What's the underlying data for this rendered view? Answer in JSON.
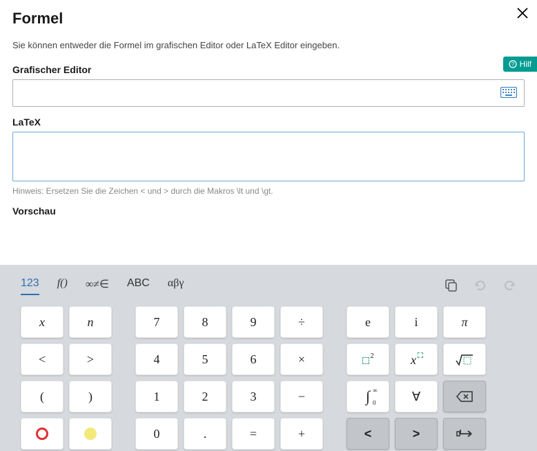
{
  "dialog": {
    "title": "Formel",
    "intro": "Sie können entweder die Formel im grafischen Editor oder LaTeX Editor eingeben.",
    "help_label": "Hilf"
  },
  "fields": {
    "graphical_label": "Grafischer Editor",
    "graphical_value": "",
    "latex_label": "LaTeX",
    "latex_value": "",
    "hint": "Hinweis: Ersetzen Sie die Zeichen < und >  durch die Makros \\lt und \\gt.",
    "preview_label": "Vorschau"
  },
  "tabs": {
    "t123": "123",
    "tf": "f()",
    "tinf": "∞≠∈",
    "tabc": "ABC",
    "tgreek": "αβγ"
  },
  "keys": {
    "x": "x",
    "n": "n",
    "lt": "<",
    "gt": ">",
    "lparen": "(",
    "rparen": ")",
    "d7": "7",
    "d8": "8",
    "d9": "9",
    "div": "÷",
    "d4": "4",
    "d5": "5",
    "d6": "6",
    "mul": "×",
    "d1": "1",
    "d2": "2",
    "d3": "3",
    "minus": "−",
    "d0": "0",
    "dot": ".",
    "eq": "=",
    "plus": "+",
    "e": "e",
    "i": "i",
    "pi": "π",
    "sup2_char": "2",
    "xsup_x": "x",
    "integral_low": "0",
    "integral_high": "∞",
    "forall": "∀",
    "chev_l": "<",
    "chev_r": ">"
  }
}
